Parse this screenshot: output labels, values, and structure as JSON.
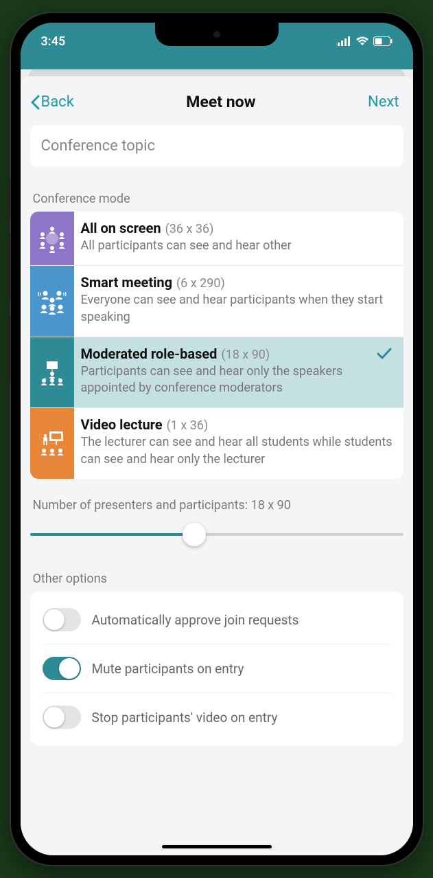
{
  "status": {
    "time": "3:45"
  },
  "nav": {
    "back": "Back",
    "title": "Meet now",
    "next": "Next"
  },
  "topic": {
    "placeholder": "Conference topic"
  },
  "mode_section_label": "Conference mode",
  "modes": [
    {
      "title": "All on screen",
      "dim": "(36 x 36)",
      "desc": "All participants can see and hear other",
      "color": "#8d76c7",
      "selected": false
    },
    {
      "title": "Smart meeting",
      "dim": "(6 x 290)",
      "desc": "Everyone can see and hear participants when they start speaking",
      "color": "#4a95cb",
      "selected": false
    },
    {
      "title": "Moderated role-based",
      "dim": "(18 x 90)",
      "desc": "Participants can see and hear only the speakers appointed by conference moderators",
      "color": "#2e8a94",
      "selected": true
    },
    {
      "title": "Video lecture",
      "dim": "(1 x 36)",
      "desc": "The lecturer can see and hear all students while students can see and hear only the lecturer",
      "color": "#e8863a",
      "selected": false
    }
  ],
  "slider_label": "Number of presenters and participants: 18 x 90",
  "other_label": "Other options",
  "options": [
    {
      "label": "Automatically approve join requests",
      "on": false
    },
    {
      "label": "Mute participants on entry",
      "on": true
    },
    {
      "label": "Stop participants' video on entry",
      "on": false
    }
  ]
}
